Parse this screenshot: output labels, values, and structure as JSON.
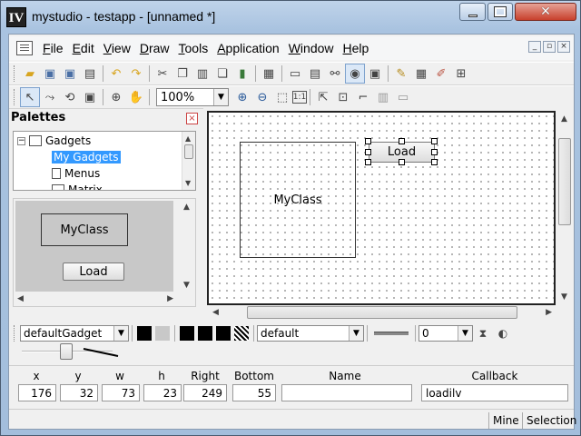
{
  "window": {
    "icon_text": "IV",
    "title": "mystudio - testapp - [unnamed *]"
  },
  "menu": {
    "items": [
      {
        "prefix": "",
        "underline": "F",
        "rest": "ile"
      },
      {
        "prefix": "",
        "underline": "E",
        "rest": "dit"
      },
      {
        "prefix": "",
        "underline": "V",
        "rest": "iew"
      },
      {
        "prefix": "",
        "underline": "D",
        "rest": "raw"
      },
      {
        "prefix": "",
        "underline": "T",
        "rest": "ools"
      },
      {
        "prefix": "",
        "underline": "A",
        "rest": "pplication"
      },
      {
        "prefix": "",
        "underline": "W",
        "rest": "indow"
      },
      {
        "prefix": "",
        "underline": "H",
        "rest": "elp"
      }
    ]
  },
  "toolbar2": {
    "zoom_value": "100%"
  },
  "palettes": {
    "title": "Palettes",
    "tree": [
      {
        "label": "Gadgets"
      },
      {
        "label": "My Gadgets"
      },
      {
        "label": "Menus"
      },
      {
        "label": "Matrix"
      }
    ],
    "preview": {
      "myclass_label": "MyClass",
      "load_label": "Load"
    }
  },
  "canvas": {
    "myclass_label": "MyClass",
    "load_label": "Load"
  },
  "attributes": {
    "gadget_combo": "defaultGadget",
    "font_combo": "default",
    "line_width": "0",
    "colors": {
      "fg_black": "#000000",
      "bg_gray": "#c8c8c8"
    }
  },
  "geometry": {
    "labels": {
      "x": "x",
      "y": "y",
      "w": "w",
      "h": "h",
      "right": "Right",
      "bottom": "Bottom",
      "name": "Name",
      "callback": "Callback"
    },
    "values": {
      "x": "176",
      "y": "32",
      "w": "73",
      "h": "23",
      "right": "249",
      "bottom": "55",
      "name": "",
      "callback": "loadilv"
    }
  },
  "status": {
    "mine": "Mine",
    "selection": "Selection"
  }
}
